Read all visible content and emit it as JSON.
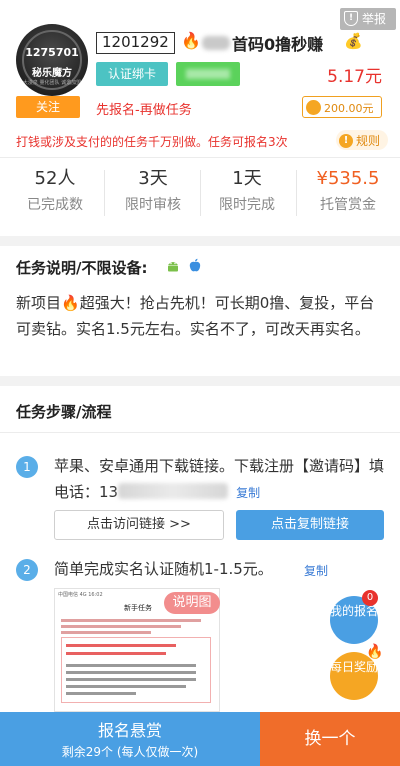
{
  "report": {
    "label": "举报",
    "icon": "shield-exclamation-icon"
  },
  "avatar": {
    "number": "1275701",
    "name": "秘乐魔方",
    "subtitle": "大漫泉 量化团队 诚邀加盟"
  },
  "header": {
    "task_id": "1201292",
    "fire_icon": "🔥",
    "title": "首码0撸秒赚",
    "moneybag_icon": "💰",
    "tag_card": "认证绑卡",
    "price": "5.17元",
    "follow_label": "关注",
    "order_tip": "先报名-再做任务",
    "deposit": "200.00元"
  },
  "warning": {
    "text": "打钱或涉及支付的的任务千万别做。任务可报名3次",
    "rule_label": "规则"
  },
  "stats": [
    {
      "value": "52人",
      "label": "已完成数"
    },
    {
      "value": "3天",
      "label": "限时审核"
    },
    {
      "value": "1天",
      "label": "限时完成"
    },
    {
      "value": "¥535.5",
      "label": "托管赏金"
    }
  ],
  "description": {
    "title": "任务说明/不限设备:",
    "text_part1": "新项目",
    "fire_icon": "🔥",
    "text_part2": "超强大！抢占先机！可长期0撸、复投，平台可卖钻。实名1.5元左右。实名不了，可改天再实名。"
  },
  "steps": {
    "title": "任务步骤/流程",
    "items": [
      {
        "num": "1",
        "text": "苹果、安卓通用下载链接。下载注册【邀请码】填电话：",
        "phone_visible": "13",
        "copy_label": "复制",
        "visit_button": "点击访问链接 >>",
        "copy_button": "点击复制链接"
      },
      {
        "num": "2",
        "text": "简单完成实名认证随机1-1.5元。",
        "copy_label": "复制",
        "image_badge": "说明图"
      }
    ]
  },
  "screenshot": {
    "status": "中国电信 4G",
    "time": "16:02",
    "header": "新手任务"
  },
  "float": {
    "my_signup": "我的报名",
    "my_signup_badge": "0",
    "daily_reward": "每日奖励"
  },
  "bottom": {
    "signup_title": "报名悬赏",
    "signup_sub": "剩余29个 (每人仅做一次)",
    "switch_label": "换一个"
  },
  "colors": {
    "primary_blue": "#4a9fe3",
    "accent_orange": "#f06d2a",
    "price_red": "#e8322d",
    "teal": "#4cc3c3"
  }
}
